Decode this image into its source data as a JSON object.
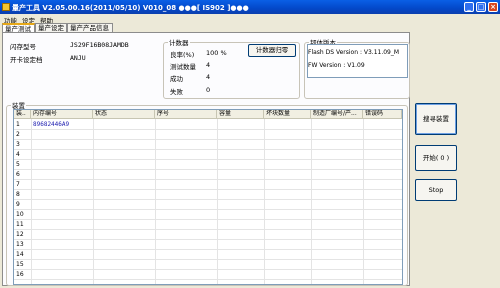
{
  "title_bar": {
    "text": "量产工具 V2.05.00.16(2011/05/10)    V010_08        ●●●[ IS902 ]●●●",
    "min": "_",
    "max": "□",
    "close": "×"
  },
  "menu": [
    "功能",
    "设定",
    "帮助"
  ],
  "tabs": [
    "量产测试",
    "量产设定",
    "量产产品信息"
  ],
  "device_info": {
    "flash_model_label": "闪存型号",
    "flash_model_value": "JS29F16B08JAMDB",
    "open_card_label": "开卡设定档",
    "open_card_value": "ANJU"
  },
  "counter": {
    "group_label": "计数器",
    "yield_label": "良率(%)",
    "yield_value": "100 %",
    "tested_label": "测试数量",
    "tested_value": "4",
    "success_label": "成功",
    "success_value": "4",
    "fail_label": "失败",
    "fail_value": "0",
    "reset_button": "计数器归零"
  },
  "firmware": {
    "group_label": "韧体版本",
    "flash_ds_version": "Flash DS Version :  V3.11.09_M",
    "fw_version": "FW Version :    V1.09"
  },
  "device_grid": {
    "group_label": "装置",
    "columns": [
      "装..",
      "内存编号",
      "状态",
      "序号",
      "容量",
      "坏块数量",
      "制造厂编号/产...",
      "错误码"
    ],
    "rows": [
      {
        "no": "1",
        "memory_id": "89682446A9"
      },
      {
        "no": "2",
        "memory_id": ""
      },
      {
        "no": "3",
        "memory_id": ""
      },
      {
        "no": "4",
        "memory_id": ""
      },
      {
        "no": "5",
        "memory_id": ""
      },
      {
        "no": "6",
        "memory_id": ""
      },
      {
        "no": "7",
        "memory_id": ""
      },
      {
        "no": "8",
        "memory_id": ""
      },
      {
        "no": "9",
        "memory_id": ""
      },
      {
        "no": "10",
        "memory_id": ""
      },
      {
        "no": "11",
        "memory_id": ""
      },
      {
        "no": "12",
        "memory_id": ""
      },
      {
        "no": "13",
        "memory_id": ""
      },
      {
        "no": "14",
        "memory_id": ""
      },
      {
        "no": "15",
        "memory_id": ""
      },
      {
        "no": "16",
        "memory_id": ""
      }
    ]
  },
  "actions": {
    "search_button": "搜寻装置",
    "start_button": "开始( 0 )",
    "stop_button": "Stop"
  }
}
